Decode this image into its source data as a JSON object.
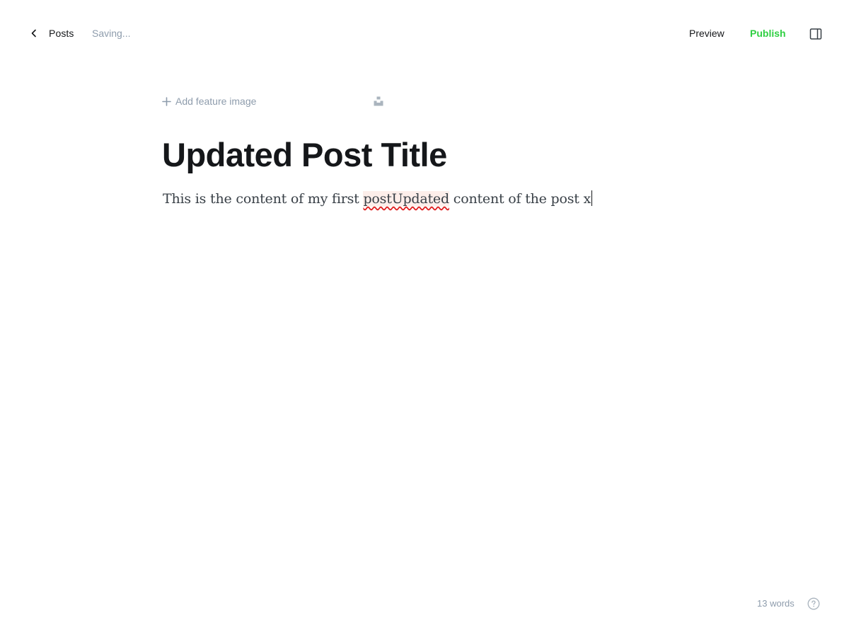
{
  "header": {
    "back_label": "Posts",
    "status": "Saving...",
    "preview_label": "Preview",
    "publish_label": "Publish",
    "publish_color": "#30cf43"
  },
  "editor": {
    "feature_image_label": "Add feature image",
    "title": "Updated Post Title",
    "body_before": "This is the content of my first ",
    "body_misspelled": "postUpdated",
    "body_after": " content of the post x"
  },
  "footer": {
    "word_count": "13 words"
  },
  "icons": {
    "back": "chevron-left-icon",
    "add": "plus-icon",
    "unsplash": "unsplash-icon",
    "sidebar": "sidebar-toggle-icon",
    "help": "help-circle-icon"
  }
}
